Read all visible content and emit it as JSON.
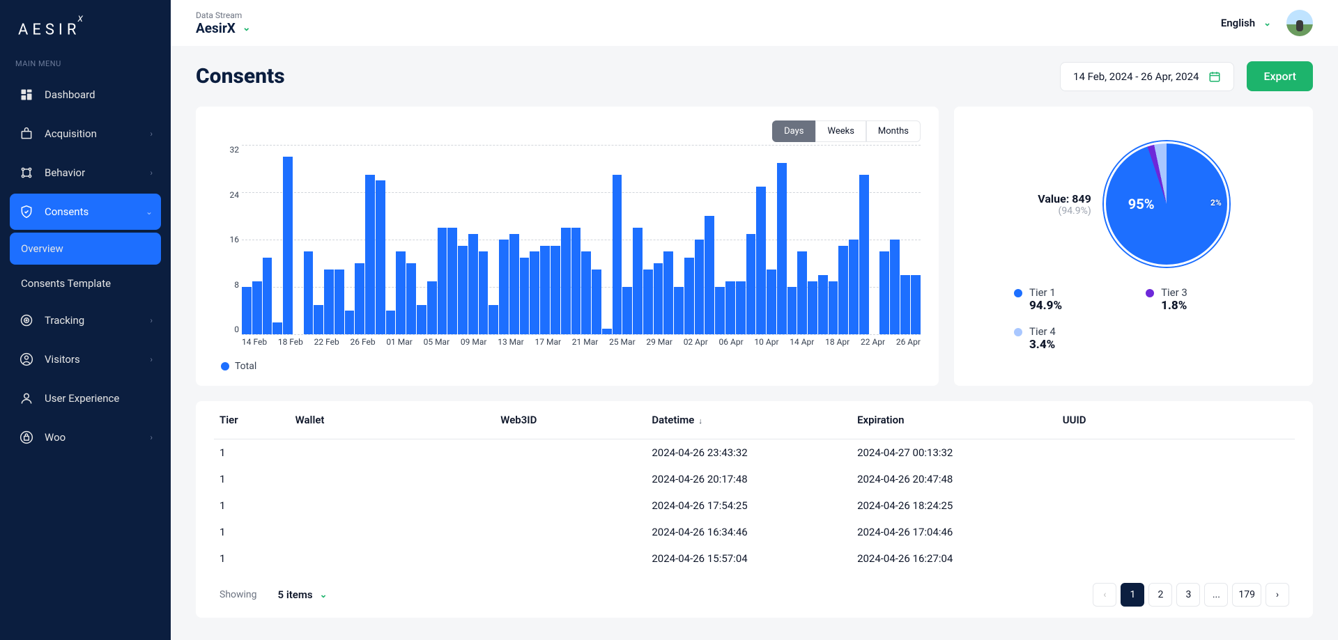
{
  "app": {
    "logo_text": "AESIR",
    "logo_suffix": "X"
  },
  "sidebar": {
    "menu_label": "MAIN MENU",
    "items": [
      {
        "label": "Dashboard",
        "icon": "dashboard",
        "expandable": false
      },
      {
        "label": "Acquisition",
        "icon": "acquisition",
        "expandable": true
      },
      {
        "label": "Behavior",
        "icon": "behavior",
        "expandable": true
      },
      {
        "label": "Consents",
        "icon": "consents",
        "expandable": true,
        "active": true,
        "children": [
          {
            "label": "Overview",
            "active": true
          },
          {
            "label": "Consents Template",
            "active": false
          }
        ]
      },
      {
        "label": "Tracking",
        "icon": "tracking",
        "expandable": true
      },
      {
        "label": "Visitors",
        "icon": "visitors",
        "expandable": true
      },
      {
        "label": "User Experience",
        "icon": "user-experience",
        "expandable": false
      },
      {
        "label": "Woo",
        "icon": "woo",
        "expandable": true
      }
    ]
  },
  "header": {
    "stream_label": "Data Stream",
    "stream_name": "AesirX",
    "language": "English"
  },
  "page": {
    "title": "Consents",
    "date_range": "14 Feb, 2024 - 26 Apr, 2024",
    "export_label": "Export"
  },
  "period_tabs": [
    "Days",
    "Weeks",
    "Months"
  ],
  "period_active": "Days",
  "chart_data": {
    "type": "bar",
    "ylim": [
      0,
      32
    ],
    "y_ticks": [
      32,
      24,
      16,
      8,
      0
    ],
    "x_ticks": [
      "14 Feb",
      "18 Feb",
      "22 Feb",
      "26 Feb",
      "01 Mar",
      "05 Mar",
      "09 Mar",
      "13 Mar",
      "17 Mar",
      "21 Mar",
      "25 Mar",
      "29 Mar",
      "02 Apr",
      "06 Apr",
      "10 Apr",
      "14 Apr",
      "18 Apr",
      "22 Apr",
      "26 Apr"
    ],
    "legend_label": "Total",
    "values": [
      8,
      9,
      13,
      2,
      30,
      0,
      14,
      5,
      11,
      11,
      4,
      12,
      27,
      26,
      4,
      14,
      12,
      5,
      9,
      18,
      18,
      15,
      17,
      14,
      5,
      16,
      17,
      13,
      14,
      15,
      15,
      18,
      18,
      14,
      11,
      1,
      27,
      8,
      18,
      11,
      12,
      14,
      8,
      13,
      16,
      20,
      8,
      9,
      9,
      17,
      25,
      11,
      29,
      8,
      14,
      9,
      10,
      9,
      15,
      16,
      27,
      0,
      14,
      16,
      10,
      10
    ]
  },
  "pie_data": {
    "type": "pie",
    "callout_value_label": "Value: 849",
    "callout_pct": "(94.9%)",
    "center_label": "95%",
    "small_label": "2%",
    "tiers": [
      {
        "name": "Tier 1",
        "pct": "94.9%",
        "color": "#1d6fff"
      },
      {
        "name": "Tier 4",
        "pct": "3.4%",
        "color": "#a9c7ff"
      },
      {
        "name": "Tier 3",
        "pct": "1.8%",
        "color": "#6d28d9"
      }
    ]
  },
  "table": {
    "columns": [
      "Tier",
      "Wallet",
      "Web3ID",
      "Datetime",
      "Expiration",
      "UUID"
    ],
    "sort_column": "Datetime",
    "rows": [
      {
        "tier": "1",
        "wallet": "",
        "web3id": "",
        "datetime": "2024-04-26 23:43:32",
        "expiration": "2024-04-27 00:13:32",
        "uuid": ""
      },
      {
        "tier": "1",
        "wallet": "",
        "web3id": "",
        "datetime": "2024-04-26 20:17:48",
        "expiration": "2024-04-26 20:47:48",
        "uuid": ""
      },
      {
        "tier": "1",
        "wallet": "",
        "web3id": "",
        "datetime": "2024-04-26 17:54:25",
        "expiration": "2024-04-26 18:24:25",
        "uuid": ""
      },
      {
        "tier": "1",
        "wallet": "",
        "web3id": "",
        "datetime": "2024-04-26 16:34:46",
        "expiration": "2024-04-26 17:04:46",
        "uuid": ""
      },
      {
        "tier": "1",
        "wallet": "",
        "web3id": "",
        "datetime": "2024-04-26 15:57:04",
        "expiration": "2024-04-26 16:27:04",
        "uuid": ""
      }
    ]
  },
  "footer": {
    "showing_label": "Showing",
    "items_label": "5 items",
    "pages": [
      "1",
      "2",
      "3",
      "...",
      "179"
    ],
    "active_page": "1"
  }
}
